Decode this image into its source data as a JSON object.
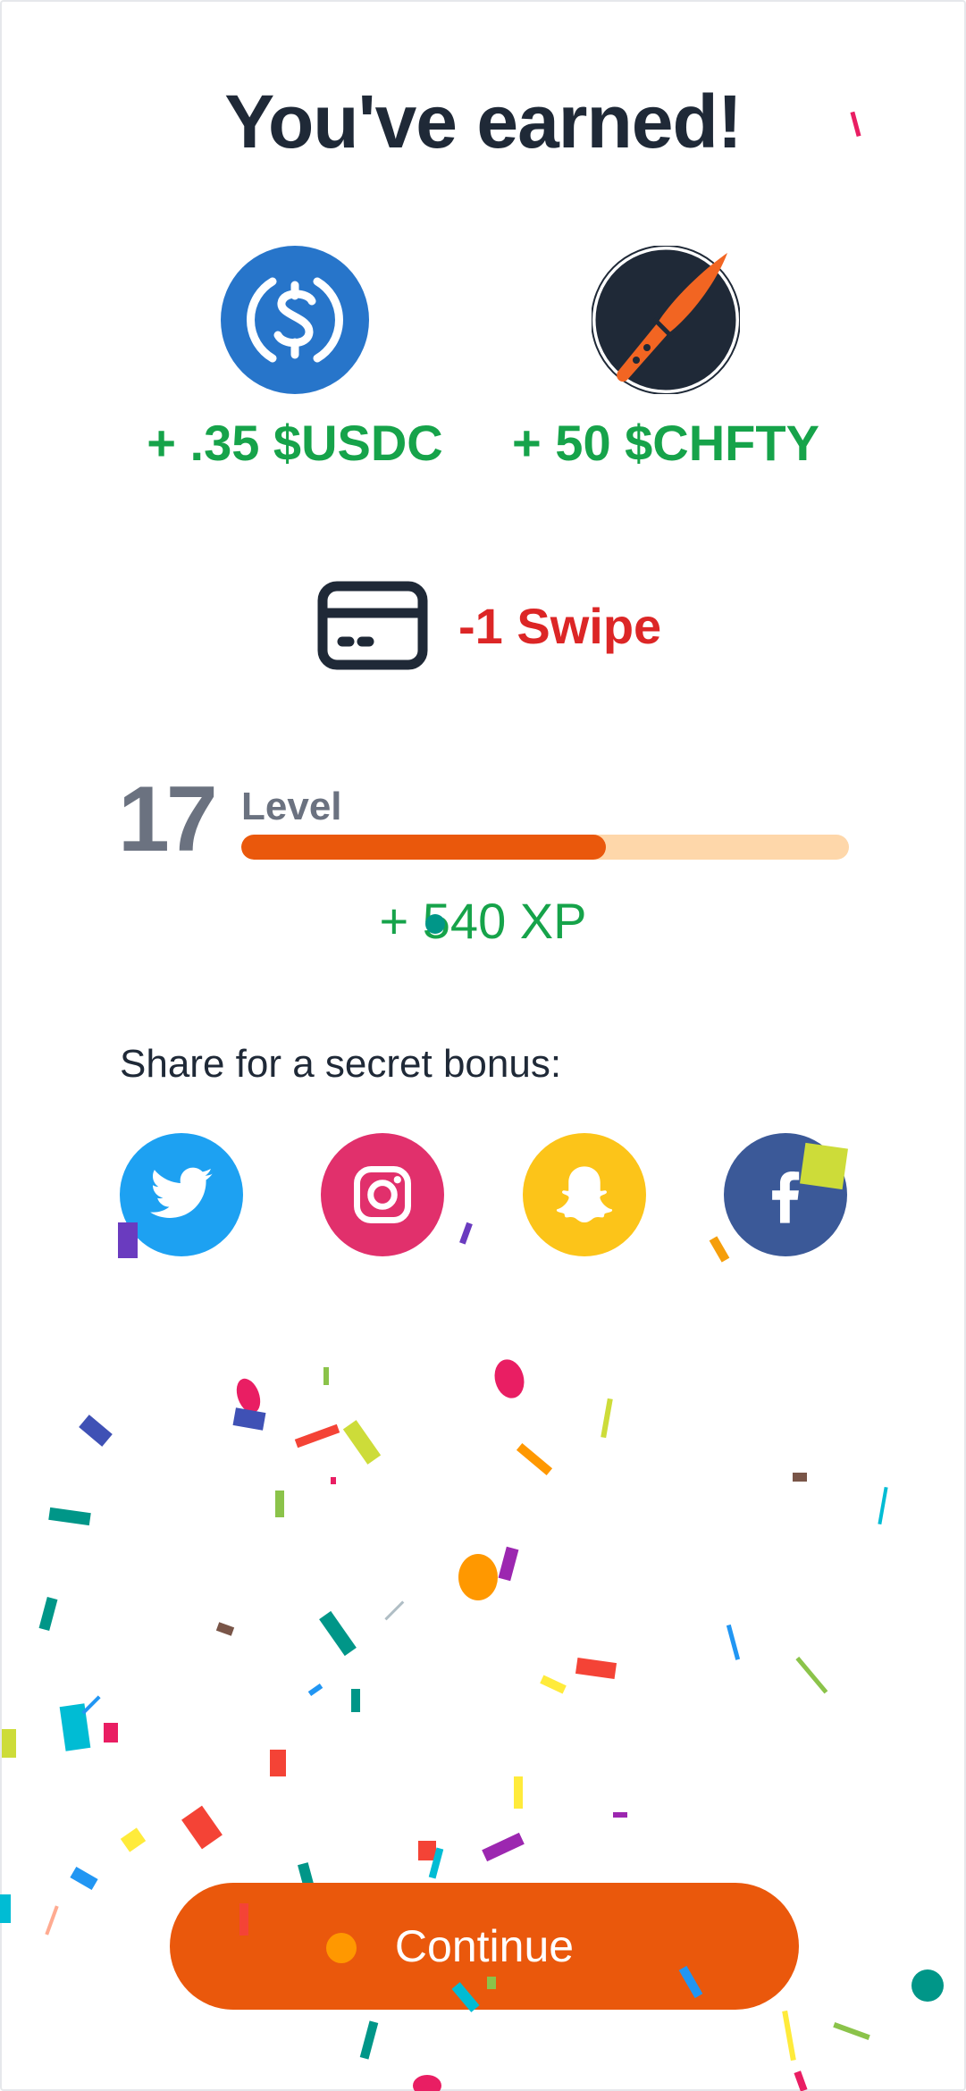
{
  "title": "You've earned!",
  "rewards": [
    {
      "icon": "usdc-coin-icon",
      "amount": "+ .35 $USDC",
      "color": "#2775ca"
    },
    {
      "icon": "chef-knife-icon",
      "amount": "+ 50 $CHFTY",
      "color": "#1f2937"
    }
  ],
  "swipe": {
    "icon": "card-icon",
    "text": "-1 Swipe"
  },
  "level": {
    "number": "17",
    "label": "Level",
    "progress": 0.6
  },
  "xp": "+ 540 XP",
  "share": {
    "label": "Share for a secret bonus:",
    "networks": [
      {
        "name": "twitter",
        "icon": "twitter-icon",
        "color": "#1da1f2"
      },
      {
        "name": "instagram",
        "icon": "instagram-icon",
        "color": "#e1306c"
      },
      {
        "name": "snapchat",
        "icon": "snapchat-icon",
        "color": "#fcc419"
      },
      {
        "name": "facebook",
        "icon": "facebook-icon",
        "color": "#3b5998"
      }
    ]
  },
  "continue_label": "Continue",
  "colors": {
    "accent": "#ea580c",
    "accent_light": "#fed7aa",
    "positive": "#16a34a",
    "negative": "#dc2626",
    "text": "#1f2937",
    "muted": "#6b7280"
  }
}
